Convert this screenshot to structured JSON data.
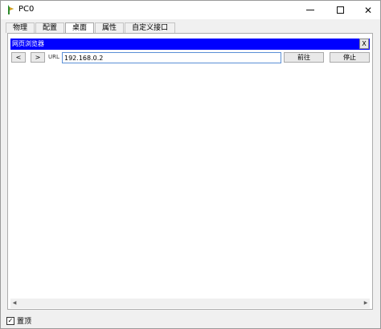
{
  "window": {
    "title": "PC0",
    "minimize_icon": "minimize-icon",
    "maximize_icon": "maximize-icon",
    "close_label": "✕"
  },
  "tabs": [
    {
      "label": "物理",
      "active": false
    },
    {
      "label": "配置",
      "active": false
    },
    {
      "label": "桌面",
      "active": true
    },
    {
      "label": "属性",
      "active": false
    },
    {
      "label": "自定义接口",
      "active": false
    }
  ],
  "browser": {
    "title": "网页浏览器",
    "close_label": "X",
    "back_label": "<",
    "forward_label": ">",
    "url_label": "URL",
    "url_value": "192.168.0.2",
    "go_label": "前往",
    "stop_label": "停止",
    "scroll_left": "◀",
    "scroll_right": "▶"
  },
  "footer": {
    "top_label": "置顶",
    "top_checked": true,
    "check_mark": "✓"
  },
  "colors": {
    "header_blue": "#0000ff",
    "url_border": "#5b8fd6"
  }
}
